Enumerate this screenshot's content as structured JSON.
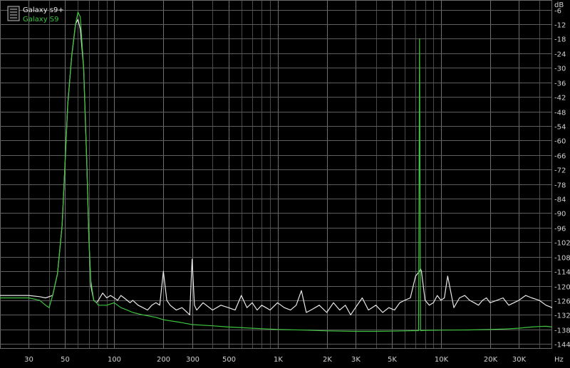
{
  "chart_data": {
    "type": "line",
    "title": "",
    "xlabel": "",
    "ylabel": "",
    "x_unit": "Hz",
    "y_unit": "dB",
    "x_scale": "log",
    "xlim": [
      20,
      48000
    ],
    "ylim": [
      -144,
      -6
    ],
    "grid": true,
    "legend_position": "top-left",
    "x_tick_labels": [
      {
        "value": 30,
        "label": "30"
      },
      {
        "value": 50,
        "label": "50"
      },
      {
        "value": 100,
        "label": "100"
      },
      {
        "value": 200,
        "label": "200"
      },
      {
        "value": 300,
        "label": "300"
      },
      {
        "value": 500,
        "label": "500"
      },
      {
        "value": 1000,
        "label": "1K"
      },
      {
        "value": 2000,
        "label": "2K"
      },
      {
        "value": 3000,
        "label": "3K"
      },
      {
        "value": 5000,
        "label": "5K"
      },
      {
        "value": 10000,
        "label": "10K"
      },
      {
        "value": 20000,
        "label": "20K"
      },
      {
        "value": 30000,
        "label": "30K"
      }
    ],
    "x_minor_ticks": [
      20,
      40,
      60,
      70,
      80,
      90,
      400,
      600,
      700,
      800,
      900,
      4000,
      6000,
      7000,
      8000,
      9000,
      40000
    ],
    "y_ticks": [
      -6,
      -12,
      -18,
      -24,
      -30,
      -36,
      -42,
      -48,
      -54,
      -60,
      -66,
      -72,
      -78,
      -84,
      -90,
      -96,
      -102,
      -108,
      -114,
      -120,
      -126,
      -132,
      -138,
      -144
    ],
    "series": [
      {
        "name": "Galaxy s9+",
        "color": "#e8e8e8",
        "x": [
          20,
          25,
          30,
          35,
          38,
          42,
          45,
          48,
          50,
          52,
          55,
          58,
          60,
          62,
          65,
          68,
          70,
          72,
          75,
          78,
          80,
          85,
          90,
          95,
          100,
          105,
          110,
          115,
          120,
          125,
          130,
          140,
          150,
          160,
          170,
          180,
          190,
          200,
          210,
          220,
          240,
          260,
          280,
          290,
          300,
          310,
          320,
          350,
          400,
          450,
          500,
          550,
          600,
          650,
          700,
          750,
          800,
          850,
          900,
          1000,
          1100,
          1200,
          1300,
          1400,
          1500,
          1600,
          1800,
          2000,
          2200,
          2400,
          2600,
          2800,
          3000,
          3300,
          3600,
          4000,
          4400,
          4800,
          5200,
          5600,
          6000,
          6500,
          7000,
          7400,
          7500,
          7600,
          8000,
          8500,
          9000,
          9500,
          10000,
          10500,
          11000,
          12000,
          13000,
          14000,
          15000,
          16000,
          17000,
          18000,
          19000,
          20000,
          22000,
          24000,
          26000,
          28000,
          30000,
          33000,
          36000,
          40000,
          44000,
          48000
        ],
        "y": [
          -124,
          -124,
          -124,
          -124.5,
          -125,
          -124,
          -115,
          -95,
          -70,
          -45,
          -25,
          -12,
          -10,
          -14,
          -30,
          -70,
          -100,
          -120,
          -126,
          -127,
          -126,
          -123,
          -125,
          -124,
          -125,
          -126,
          -124,
          -125,
          -126,
          -127,
          -126,
          -128,
          -129,
          -130,
          -128,
          -127,
          -128,
          -114,
          -126,
          -128,
          -130,
          -129,
          -131,
          -132,
          -109,
          -128,
          -130,
          -127,
          -130,
          -128,
          -129,
          -130,
          -124,
          -129,
          -127,
          -130,
          -128,
          -129,
          -130,
          -127,
          -129,
          -130,
          -128,
          -122,
          -131,
          -130,
          -128,
          -131,
          -127,
          -130,
          -128,
          -132,
          -129,
          -125,
          -130,
          -128,
          -131,
          -129,
          -130,
          -127,
          -126,
          -125,
          -116,
          -114,
          -113,
          -114,
          -126,
          -128,
          -127,
          -124,
          -126,
          -125,
          -116,
          -129,
          -125,
          -124,
          -126,
          -127,
          -128,
          -126,
          -125,
          -127,
          -126,
          -125,
          -128,
          -127,
          -126,
          -124,
          -125,
          -126,
          -128,
          -129
        ]
      },
      {
        "name": "Galaxy S9",
        "color": "#3ec43e",
        "x": [
          20,
          25,
          30,
          35,
          38,
          40,
          42,
          45,
          48,
          50,
          52,
          55,
          58,
          60,
          62,
          65,
          68,
          70,
          72,
          75,
          78,
          80,
          90,
          100,
          110,
          120,
          130,
          150,
          180,
          200,
          250,
          300,
          400,
          500,
          700,
          1000,
          1500,
          2000,
          3000,
          4000,
          5000,
          6000,
          7000,
          7300,
          7400,
          7500,
          7600,
          8000,
          10000,
          15000,
          20000,
          25000,
          30000,
          33000,
          36000,
          40000,
          44000,
          48000
        ],
        "y": [
          -125,
          -125,
          -125,
          -126,
          -128,
          -129,
          -124,
          -115,
          -95,
          -70,
          -45,
          -25,
          -12,
          -7,
          -9,
          -30,
          -70,
          -100,
          -118,
          -126,
          -127,
          -128,
          -128,
          -127,
          -129,
          -130,
          -131,
          -132,
          -133,
          -134,
          -135,
          -136,
          -136.5,
          -137,
          -137.5,
          -138,
          -138.3,
          -138.6,
          -138.8,
          -138.8,
          -138.7,
          -138.6,
          -138.5,
          -138.5,
          -18,
          -138.5,
          -138.5,
          -138.4,
          -138.3,
          -138.2,
          -138.0,
          -137.8,
          -137.5,
          -137.2,
          -137.0,
          -136.8,
          -136.7,
          -137.0
        ]
      }
    ]
  }
}
